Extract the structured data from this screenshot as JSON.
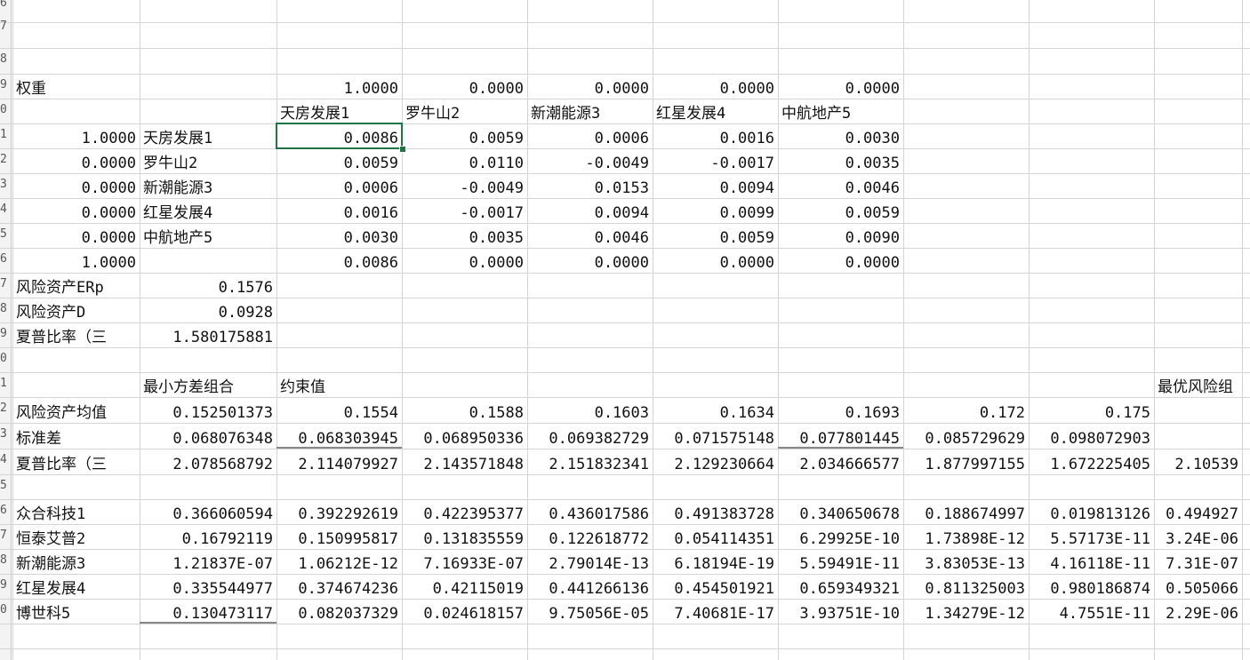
{
  "row_numbers": [
    "6",
    "7",
    "8",
    "9",
    "0",
    "1",
    "2",
    "3",
    "4",
    "5",
    "6",
    "7",
    "8",
    "9",
    "0",
    "1",
    "2",
    "3",
    "4",
    "5",
    "6",
    "7",
    "8",
    "9",
    "0"
  ],
  "cells": {
    "r9": {
      "a": "权重",
      "c": "1.0000",
      "d": "0.0000",
      "e": "0.0000",
      "f": "0.0000",
      "g": "0.0000"
    },
    "r10": {
      "c": "天房发展1",
      "d": "罗牛山2",
      "e": "新潮能源3",
      "f": "红星发展4",
      "g": "中航地产5"
    },
    "r11": {
      "a": "1.0000",
      "b": "天房发展1",
      "c": "0.0086",
      "d": "0.0059",
      "e": "0.0006",
      "f": "0.0016",
      "g": "0.0030"
    },
    "r12": {
      "a": "0.0000",
      "b": "罗牛山2",
      "c": "0.0059",
      "d": "0.0110",
      "e": "-0.0049",
      "f": "-0.0017",
      "g": "0.0035"
    },
    "r13": {
      "a": "0.0000",
      "b": "新潮能源3",
      "c": "0.0006",
      "d": "-0.0049",
      "e": "0.0153",
      "f": "0.0094",
      "g": "0.0046"
    },
    "r14": {
      "a": "0.0000",
      "b": "红星发展4",
      "c": "0.0016",
      "d": "-0.0017",
      "e": "0.0094",
      "f": "0.0099",
      "g": "0.0059"
    },
    "r15": {
      "a": "0.0000",
      "b": "中航地产5",
      "c": "0.0030",
      "d": "0.0035",
      "e": "0.0046",
      "f": "0.0059",
      "g": "0.0090"
    },
    "r16": {
      "a": "1.0000",
      "c": "0.0086",
      "d": "0.0000",
      "e": "0.0000",
      "f": "0.0000",
      "g": "0.0000"
    },
    "r17": {
      "a": "风险资产ERp",
      "b": "0.1576"
    },
    "r18": {
      "a": "风险资产D",
      "b": "0.0928"
    },
    "r19": {
      "a": "夏普比率（三",
      "b": "1.580175881"
    },
    "r21": {
      "b": "最小方差组合",
      "c": "约束值",
      "j": "最优风险组"
    },
    "r22": {
      "a": "风险资产均值",
      "b": "0.152501373",
      "c": "0.1554",
      "d": "0.1588",
      "e": "0.1603",
      "f": "0.1634",
      "g": "0.1693",
      "h": "0.172",
      "i": "0.175"
    },
    "r23": {
      "a": "标准差",
      "b": "0.068076348",
      "c": "0.068303945",
      "d": "0.068950336",
      "e": "0.069382729",
      "f": "0.071575148",
      "g": "0.077801445",
      "h": "0.085729629",
      "i": "0.098072903"
    },
    "r24": {
      "a": "夏普比率（三",
      "b": "2.078568792",
      "c": "2.114079927",
      "d": "2.143571848",
      "e": "2.151832341",
      "f": "2.129230664",
      "g": "2.034666577",
      "h": "1.877997155",
      "i": "1.672225405",
      "j": "2.10539"
    },
    "r26": {
      "a": "众合科技1",
      "b": "0.366060594",
      "c": "0.392292619",
      "d": "0.422395377",
      "e": "0.436017586",
      "f": "0.491383728",
      "g": "0.340650678",
      "h": "0.188674997",
      "i": "0.019813126",
      "j": "0.494927"
    },
    "r27": {
      "a": "恒泰艾普2",
      "b": "0.16792119",
      "c": "0.150995817",
      "d": "0.131835559",
      "e": "0.122618772",
      "f": "0.054114351",
      "g": "6.29925E-10",
      "h": "1.73898E-12",
      "i": "5.57173E-11",
      "j": "3.24E-06"
    },
    "r28": {
      "a": "新潮能源3",
      "b": "1.21837E-07",
      "c": "1.06212E-12",
      "d": "7.16933E-07",
      "e": "2.79014E-13",
      "f": "6.18194E-19",
      "g": "5.59491E-11",
      "h": "3.83053E-13",
      "i": "4.16118E-11",
      "j": "7.31E-07"
    },
    "r29": {
      "a": "红星发展4",
      "b": "0.335544977",
      "c": "0.374674236",
      "d": "0.42115019",
      "e": "0.441266136",
      "f": "0.454501921",
      "g": "0.659349321",
      "h": "0.811325003",
      "i": "0.980186874",
      "j": "0.505066"
    },
    "r30": {
      "a": "博世科5",
      "b": "0.130473117",
      "c": "0.082037329",
      "d": "0.024618157",
      "e": "9.75056E-05",
      "f": "7.40681E-17",
      "g": "3.93751E-10",
      "h": "1.34279E-12",
      "i": "4.7551E-11",
      "j": "2.29E-06"
    }
  },
  "colors": {
    "grid": "#d4d4d4",
    "selection": "#217346",
    "header_bg": "#f3f3f3"
  }
}
